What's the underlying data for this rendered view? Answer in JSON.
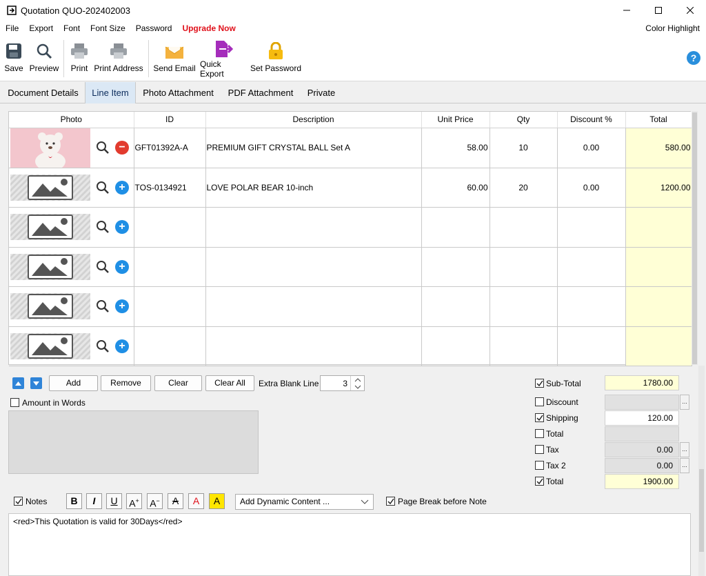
{
  "window": {
    "title": "Quotation QUO-202402003"
  },
  "menu": {
    "items": [
      "File",
      "Export",
      "Font",
      "Font Size",
      "Password"
    ],
    "upgrade": "Upgrade Now",
    "color_highlight": "Color Highlight"
  },
  "toolbar": {
    "save": "Save",
    "preview": "Preview",
    "print": "Print",
    "print_address": "Print Address",
    "send_email": "Send Email",
    "quick_export": "Quick Export",
    "set_password": "Set Password"
  },
  "tabs": [
    "Document Details",
    "Line Item",
    "Photo Attachment",
    "PDF Attachment",
    "Private"
  ],
  "grid": {
    "columns": [
      "Photo",
      "ID",
      "Description",
      "Unit Price",
      "Qty",
      "Discount %",
      "Total"
    ],
    "rows": [
      {
        "id": "GFT01392A-A",
        "description": "PREMIUM GIFT CRYSTAL BALL Set A",
        "unit_price": "58.00",
        "qty": "10",
        "discount": "0.00",
        "total": "580.00",
        "photo": "bear"
      },
      {
        "id": "TOS-0134921",
        "description": "LOVE POLAR BEAR 10-inch",
        "unit_price": "60.00",
        "qty": "20",
        "discount": "0.00",
        "total": "1200.00",
        "photo": "placeholder"
      },
      {
        "id": "",
        "description": "",
        "unit_price": "",
        "qty": "",
        "discount": "",
        "total": "",
        "photo": "placeholder"
      },
      {
        "id": "",
        "description": "",
        "unit_price": "",
        "qty": "",
        "discount": "",
        "total": "",
        "photo": "placeholder"
      },
      {
        "id": "",
        "description": "",
        "unit_price": "",
        "qty": "",
        "discount": "",
        "total": "",
        "photo": "placeholder"
      },
      {
        "id": "",
        "description": "",
        "unit_price": "",
        "qty": "",
        "discount": "",
        "total": "",
        "photo": "placeholder"
      }
    ]
  },
  "actions": {
    "add": "Add",
    "remove": "Remove",
    "clear": "Clear",
    "clear_all": "Clear All",
    "extra_blank_line_label": "Extra Blank Line",
    "extra_blank_line_value": "3"
  },
  "amount_in_words": {
    "label": "Amount in Words",
    "checked": false
  },
  "summary": {
    "subtotal": {
      "label": "Sub-Total",
      "value": "1780.00",
      "checked": true
    },
    "discount": {
      "label": "Discount",
      "value": "",
      "checked": false
    },
    "shipping": {
      "label": "Shipping",
      "value": "120.00",
      "checked": true
    },
    "total1": {
      "label": "Total",
      "value": "",
      "checked": false
    },
    "tax": {
      "label": "Tax",
      "value": "0.00",
      "checked": false
    },
    "tax2": {
      "label": "Tax 2",
      "value": "0.00",
      "checked": false
    },
    "total": {
      "label": "Total",
      "value": "1900.00",
      "checked": true
    }
  },
  "notes": {
    "label": "Notes",
    "checked": true,
    "dynamic_content": "Add Dynamic Content ...",
    "page_break_label": "Page Break before Note",
    "page_break_checked": true,
    "text": "<red>This Quotation is valid for 30Days</red>"
  },
  "colors": {
    "accent": "#1f8fe5",
    "highlight": "#ffffd6",
    "upgrade": "#e0101a",
    "remove": "#e23b2e"
  }
}
